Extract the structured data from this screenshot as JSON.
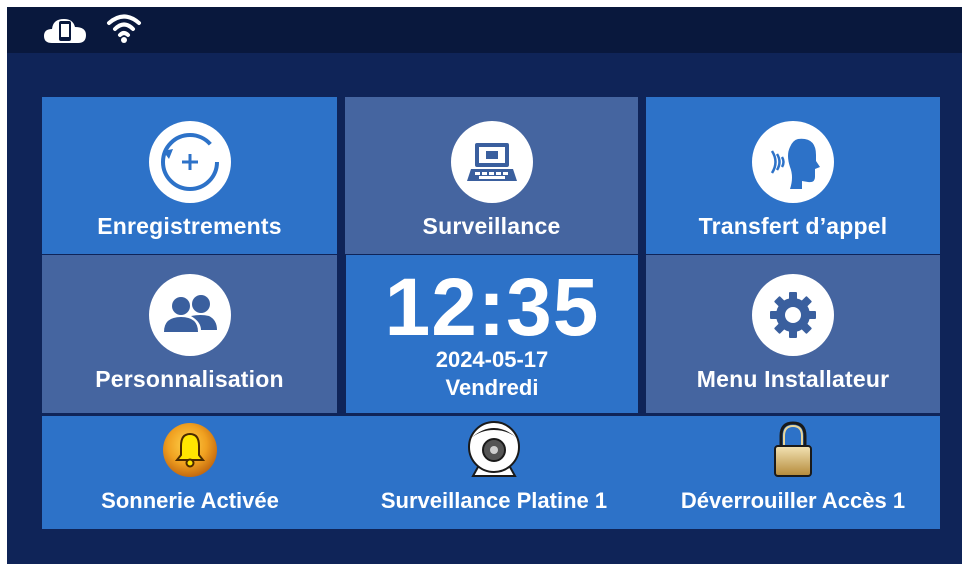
{
  "status_bar": {
    "icons": [
      "cloud-phone-icon",
      "wifi-icon"
    ]
  },
  "tiles": {
    "recordings": {
      "label": "Enregistrements",
      "icon": "recordings-icon"
    },
    "surveillance": {
      "label": "Surveillance",
      "icon": "laptop-icon"
    },
    "call_transfer": {
      "label": "Transfert d’appel",
      "icon": "speaking-head-icon"
    },
    "personalization": {
      "label": "Personnalisation",
      "icon": "users-icon"
    },
    "installer_menu": {
      "label": "Menu Installateur",
      "icon": "gear-icon"
    }
  },
  "clock": {
    "time": "12:35",
    "date": "2024-05-17",
    "day": "Vendredi"
  },
  "bottom_bar": {
    "ringer": {
      "label": "Sonnerie Activée",
      "icon": "bell-icon"
    },
    "station_surveillance": {
      "label": "Surveillance Platine 1",
      "icon": "camera-icon"
    },
    "unlock": {
      "label": "Déverrouiller Accès 1",
      "icon": "padlock-icon"
    }
  },
  "colors": {
    "background": "#0f2458",
    "status_bar": "#09183d",
    "tile_blue": "#2d72c8",
    "tile_grey": "#4565a0",
    "text": "#ffffff"
  }
}
